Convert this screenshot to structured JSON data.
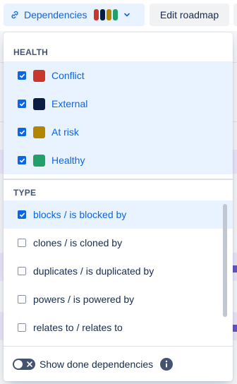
{
  "toolbar": {
    "dependencies_label": "Dependencies",
    "edit_roadmap_label": "Edit roadmap",
    "swatch_colors": [
      "#C9372C",
      "#091E42",
      "#B38600",
      "#22A06B"
    ]
  },
  "popup": {
    "health": {
      "heading": "HEALTH",
      "items": [
        {
          "label": "Conflict",
          "color": "#C9372C",
          "checked": true
        },
        {
          "label": "External",
          "color": "#091E42",
          "checked": true
        },
        {
          "label": "At risk",
          "color": "#B38600",
          "checked": true
        },
        {
          "label": "Healthy",
          "color": "#22A06B",
          "checked": true
        }
      ]
    },
    "type": {
      "heading": "TYPE",
      "items": [
        {
          "label": "blocks / is blocked by",
          "checked": true
        },
        {
          "label": "clones / is cloned by",
          "checked": false
        },
        {
          "label": "duplicates / is duplicated by",
          "checked": false
        },
        {
          "label": "powers / is powered by",
          "checked": false
        },
        {
          "label": "relates to / relates to",
          "checked": false
        }
      ]
    },
    "footer": {
      "toggle_label": "Show done dependencies",
      "toggle_on": false
    }
  }
}
